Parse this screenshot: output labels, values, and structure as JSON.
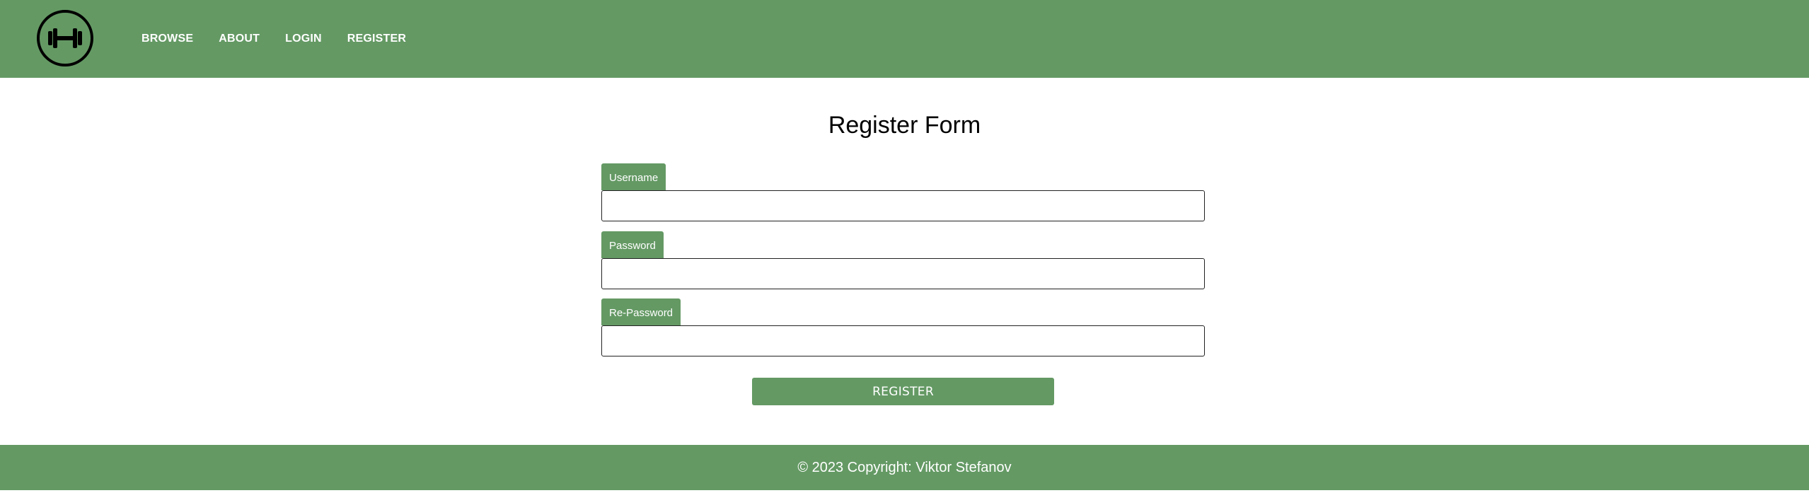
{
  "header": {
    "logo_icon": "dumbbell-icon",
    "nav": [
      {
        "label": "BROWSE"
      },
      {
        "label": "ABOUT"
      },
      {
        "label": "LOGIN"
      },
      {
        "label": "REGISTER"
      }
    ]
  },
  "form": {
    "title": "Register Form",
    "fields": [
      {
        "label": "Username",
        "value": "",
        "type": "text"
      },
      {
        "label": "Password",
        "value": "",
        "type": "password"
      },
      {
        "label": "Re-Password",
        "value": "",
        "type": "password"
      }
    ],
    "submit_label": "REGISTER"
  },
  "footer": {
    "text": "© 2023 Copyright: Viktor Stefanov"
  },
  "colors": {
    "accent": "#649964",
    "text_on_accent": "#ffffff",
    "background": "#ffffff"
  }
}
